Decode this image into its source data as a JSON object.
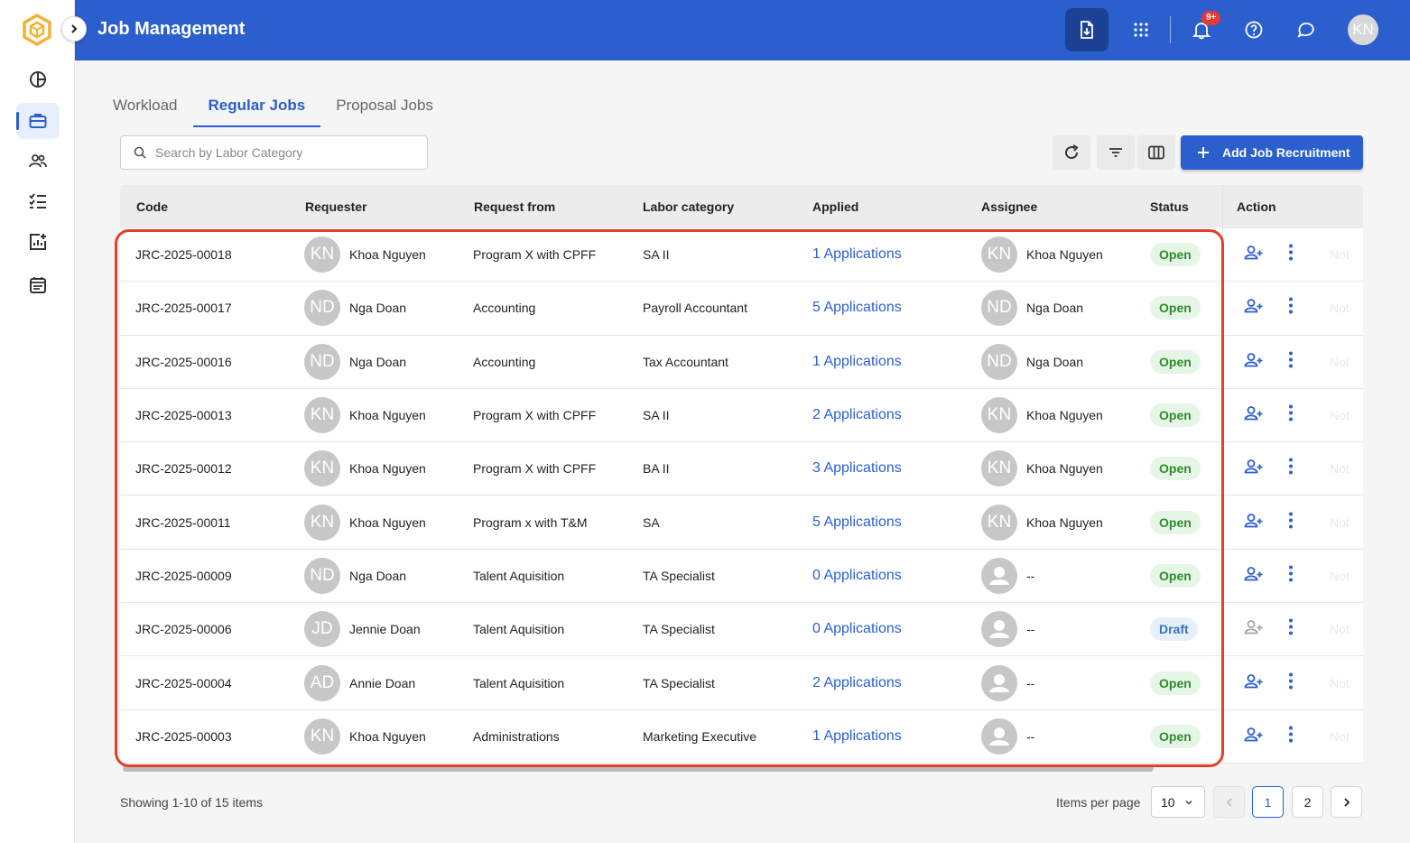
{
  "header": {
    "title": "Job Management",
    "notification_badge": "9+",
    "avatar_initials": "KN"
  },
  "tabs": [
    {
      "label": "Workload",
      "active": false
    },
    {
      "label": "Regular Jobs",
      "active": true
    },
    {
      "label": "Proposal Jobs",
      "active": false
    }
  ],
  "search": {
    "placeholder": "Search by Labor Category",
    "value": ""
  },
  "toolbar": {
    "add_label": "Add Job Recruitment"
  },
  "table": {
    "columns": [
      "Code",
      "Requester",
      "Request from",
      "Labor category",
      "Applied",
      "Assignee",
      "Status",
      "Action"
    ],
    "rows": [
      {
        "code": "JRC-2025-00018",
        "requester_initials": "KN",
        "requester": "Khoa Nguyen",
        "request_from": "Program X with CPFF",
        "labor_category": "SA II",
        "applied": "1 Applications",
        "assignee_initials": "KN",
        "assignee": "Khoa Nguyen",
        "status": "Open",
        "ghost": "Not"
      },
      {
        "code": "JRC-2025-00017",
        "requester_initials": "ND",
        "requester": "Nga Doan",
        "request_from": "Accounting",
        "labor_category": "Payroll Accountant",
        "applied": "5 Applications",
        "assignee_initials": "ND",
        "assignee": "Nga Doan",
        "status": "Open",
        "ghost": "Not"
      },
      {
        "code": "JRC-2025-00016",
        "requester_initials": "ND",
        "requester": "Nga Doan",
        "request_from": "Accounting",
        "labor_category": "Tax Accountant",
        "applied": "1 Applications",
        "assignee_initials": "ND",
        "assignee": "Nga Doan",
        "status": "Open",
        "ghost": "Not"
      },
      {
        "code": "JRC-2025-00013",
        "requester_initials": "KN",
        "requester": "Khoa Nguyen",
        "request_from": "Program X with CPFF",
        "labor_category": "SA II",
        "applied": "2 Applications",
        "assignee_initials": "KN",
        "assignee": "Khoa Nguyen",
        "status": "Open",
        "ghost": "Not"
      },
      {
        "code": "JRC-2025-00012",
        "requester_initials": "KN",
        "requester": "Khoa Nguyen",
        "request_from": "Program X with CPFF",
        "labor_category": "BA II",
        "applied": "3 Applications",
        "assignee_initials": "KN",
        "assignee": "Khoa Nguyen",
        "status": "Open",
        "ghost": "Not"
      },
      {
        "code": "JRC-2025-00011",
        "requester_initials": "KN",
        "requester": "Khoa Nguyen",
        "request_from": "Program x with T&M",
        "labor_category": "SA",
        "applied": "5 Applications",
        "assignee_initials": "KN",
        "assignee": "Khoa Nguyen",
        "status": "Open",
        "ghost": "Not"
      },
      {
        "code": "JRC-2025-00009",
        "requester_initials": "ND",
        "requester": "Nga Doan",
        "request_from": "Talent Aquisition",
        "labor_category": "TA Specialist",
        "applied": "0 Applications",
        "assignee_initials": "",
        "assignee": "--",
        "status": "Open",
        "ghost": "Not"
      },
      {
        "code": "JRC-2025-00006",
        "requester_initials": "JD",
        "requester": "Jennie Doan",
        "request_from": "Talent Aquisition",
        "labor_category": "TA Specialist",
        "applied": "0 Applications",
        "assignee_initials": "",
        "assignee": "--",
        "status": "Draft",
        "ghost": "Not"
      },
      {
        "code": "JRC-2025-00004",
        "requester_initials": "AD",
        "requester": "Annie Doan",
        "request_from": "Talent Aquisition",
        "labor_category": "TA Specialist",
        "applied": "2 Applications",
        "assignee_initials": "",
        "assignee": "--",
        "status": "Open",
        "ghost": "Not"
      },
      {
        "code": "JRC-2025-00003",
        "requester_initials": "KN",
        "requester": "Khoa Nguyen",
        "request_from": "Administrations",
        "labor_category": "Marketing Executive",
        "applied": "1 Applications",
        "assignee_initials": "",
        "assignee": "--",
        "status": "Open",
        "ghost": "Not"
      }
    ]
  },
  "footer": {
    "showing": "Showing 1-10 of 15 items",
    "items_per_page_label": "Items per page",
    "items_per_page": "10",
    "pages": [
      "1",
      "2"
    ],
    "current_page": "1"
  },
  "colors": {
    "primary": "#2b5fce",
    "open": "#2e8b2e",
    "draft": "#3a73b8",
    "highlight": "#e53e2b"
  },
  "icons": [
    "logo-icon",
    "chevron-right-icon",
    "pie-chart-icon",
    "briefcase-icon",
    "users-icon",
    "checklist-icon",
    "report-add-icon",
    "calendar-icon",
    "download-doc-icon",
    "apps-grid-icon",
    "bell-icon",
    "help-icon",
    "chat-icon",
    "search-icon",
    "refresh-icon",
    "filter-icon",
    "columns-icon",
    "plus-icon",
    "user-add-icon",
    "more-vertical-icon"
  ]
}
